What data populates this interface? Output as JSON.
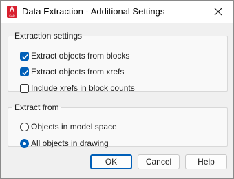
{
  "window": {
    "title": "Data Extraction - Additional Settings",
    "app_icon": {
      "name": "autocad-app-icon",
      "letter": "A",
      "sub": "CAD"
    },
    "close_icon": "close-icon"
  },
  "extraction_settings": {
    "label": "Extraction settings",
    "options": [
      {
        "label": "Extract objects from blocks",
        "checked": true
      },
      {
        "label": "Extract objects from xrefs",
        "checked": true
      },
      {
        "label": "Include xrefs in block counts",
        "checked": false
      }
    ]
  },
  "extract_from": {
    "label": "Extract from",
    "options": [
      {
        "label": "Objects in model space",
        "selected": false
      },
      {
        "label": "All objects in drawing",
        "selected": true
      }
    ]
  },
  "buttons": {
    "ok": "OK",
    "cancel": "Cancel",
    "help": "Help"
  },
  "colors": {
    "accent": "#005fb8",
    "app_icon": "#d8202f"
  }
}
